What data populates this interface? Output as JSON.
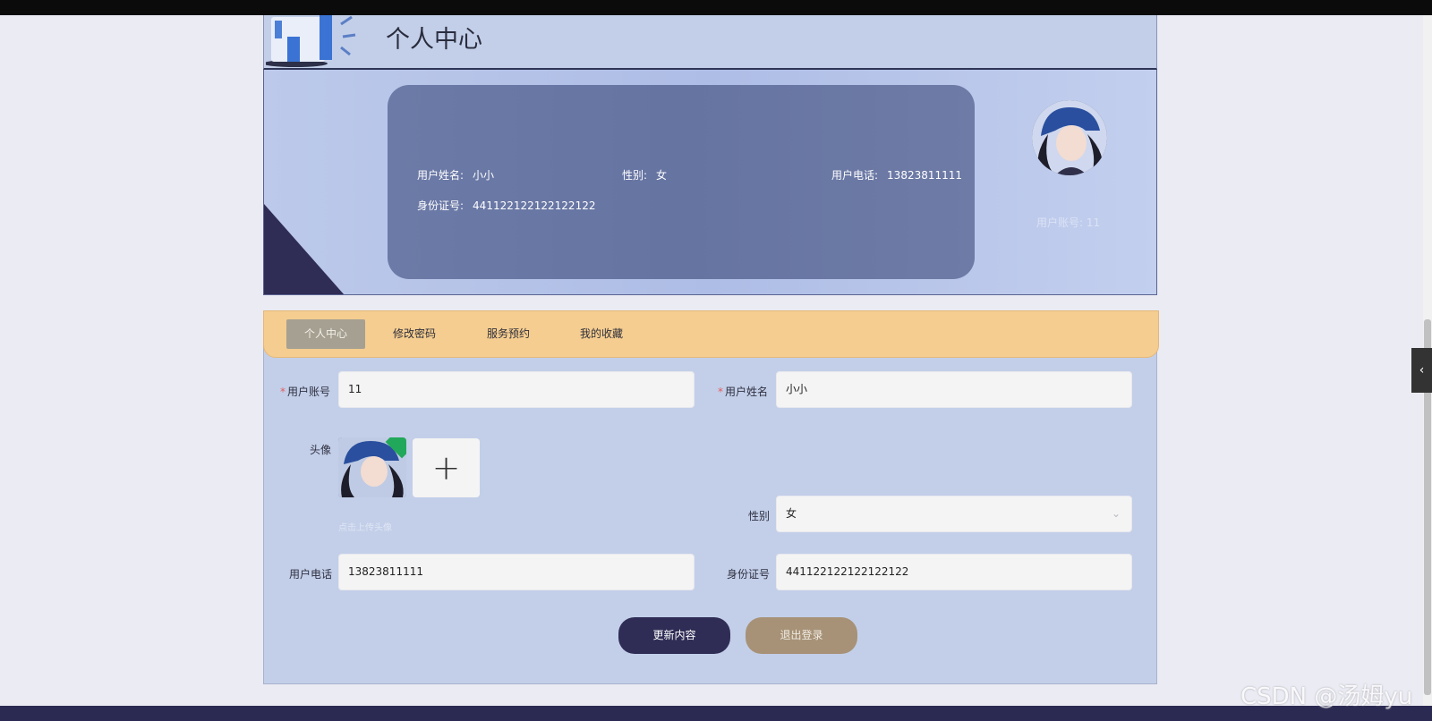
{
  "header": {
    "title": "个人中心"
  },
  "profile": {
    "name_label": "用户姓名:",
    "name_value": "小小",
    "gender_label": "性别:",
    "gender_value": "女",
    "phone_label": "用户电话:",
    "phone_value": "13823811111",
    "id_label": "身份证号:",
    "id_value": "441122122122122122",
    "account_faded": "用户账号:  11"
  },
  "tabs": [
    {
      "label": "个人中心",
      "active": true
    },
    {
      "label": "修改密码",
      "active": false
    },
    {
      "label": "服务预约",
      "active": false
    },
    {
      "label": "我的收藏",
      "active": false
    }
  ],
  "form": {
    "account_label": "用户账号",
    "account_value": "11",
    "name_label": "用户姓名",
    "name_value": "小小",
    "avatar_label": "头像",
    "avatar_hint": "点击上传头像",
    "gender_label": "性别",
    "gender_value": "女",
    "phone_label": "用户电话",
    "phone_value": "13823811111",
    "id_label": "身份证号",
    "id_value": "441122122122122122",
    "update_button": "更新内容",
    "logout_button": "退出登录"
  },
  "watermark": "CSDN @汤姆yu",
  "colors": {
    "nav_bg": "#f5cd90",
    "primary_button": "#2f2d55",
    "secondary_button": "#a79277",
    "panel_bg": "#c3cfe9"
  },
  "icons": {
    "sidebar_toggle": "chevron-left-icon",
    "upload": "plus-icon",
    "select": "chevron-down-icon"
  }
}
